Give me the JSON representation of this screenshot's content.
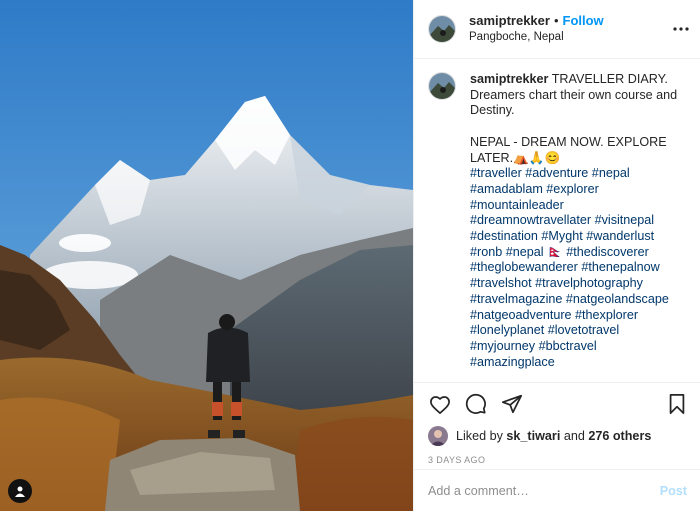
{
  "post": {
    "username": "samiptrekker",
    "separator": "•",
    "follow_label": "Follow",
    "location": "Pangboche, Nepal",
    "more_icon": "more-options-icon"
  },
  "caption": {
    "username": "samiptrekker",
    "text": "TRAVELLER DIARY. Dreamers chart their own course and Destiny.\n\nNEPAL - DREAM NOW. EXPLORE LATER.⛺🙏😊",
    "hashtag_lines": [
      "#traveller #adventure #nepal",
      "#amadablam #explorer",
      "#mountainleader",
      "#dreamnowtravellater #visitnepal",
      "#destination #Myght #wanderlust",
      "#ronb #nepal 🇳🇵 #thediscoverer",
      "#theglobewanderer #thenepalnow",
      "#travelshot #travelphotography",
      "#travelmagazine #natgeolandscape",
      "#natgeoadventure #thexplorer",
      "#lonelyplanet #lovetotravel",
      "#myjourney #bbctravel",
      "#amazingplace"
    ]
  },
  "actions": {
    "like_icon": "heart-icon",
    "comment_icon": "comment-icon",
    "share_icon": "share-icon",
    "save_icon": "bookmark-icon"
  },
  "likes": {
    "prefix": "Liked by ",
    "user": "sk_tiwari",
    "middle": " and ",
    "others": "276 others"
  },
  "date": "3 DAYS AGO",
  "comment": {
    "placeholder": "Add a comment…",
    "post_label": "Post"
  },
  "colors": {
    "accent": "#0095f6",
    "hashtag": "#00376b",
    "muted": "#8e8e8e",
    "post_disabled": "#b2dffc"
  }
}
